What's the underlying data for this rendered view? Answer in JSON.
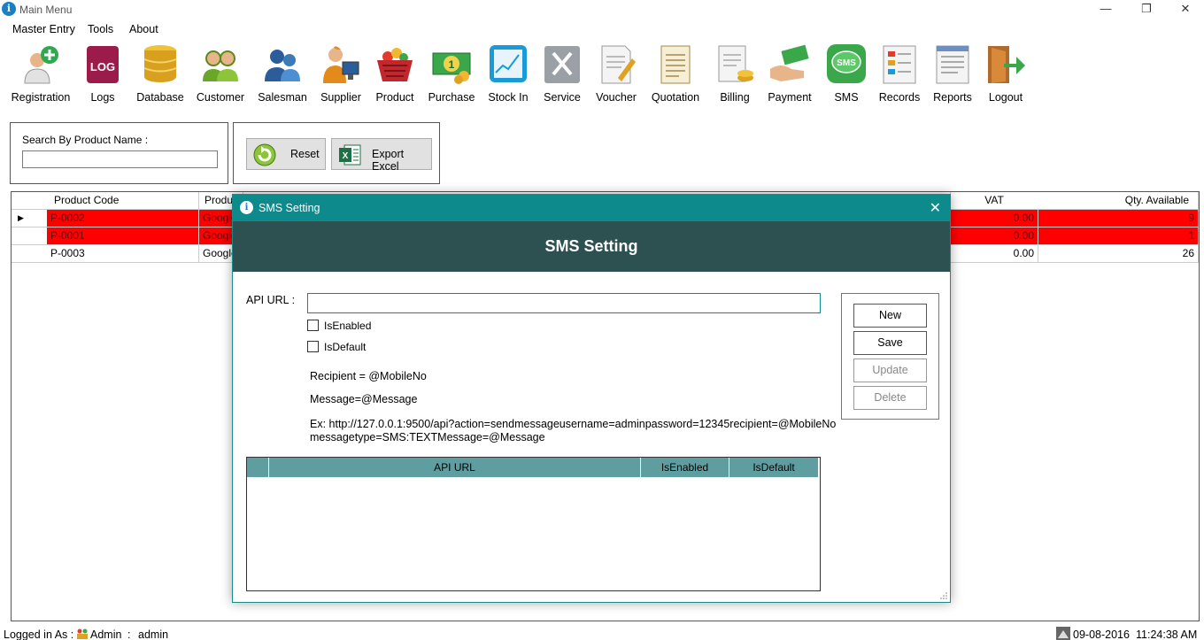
{
  "window": {
    "title": "Main Menu",
    "controls": [
      "—",
      "❐",
      "✕"
    ]
  },
  "menu": [
    "Master Entry",
    "Tools",
    "About"
  ],
  "toolbar": [
    {
      "label": "Registration",
      "icon": "registration-icon"
    },
    {
      "label": "Logs",
      "icon": "log-icon"
    },
    {
      "label": "Database",
      "icon": "database-icon"
    },
    {
      "label": "Customer",
      "icon": "customer-icon"
    },
    {
      "label": "Salesman",
      "icon": "salesman-icon"
    },
    {
      "label": "Supplier",
      "icon": "supplier-icon"
    },
    {
      "label": "Product",
      "icon": "product-basket-icon"
    },
    {
      "label": "Purchase",
      "icon": "money-icon"
    },
    {
      "label": "Stock In",
      "icon": "stock-chart-icon"
    },
    {
      "label": "Service",
      "icon": "tools-icon"
    },
    {
      "label": "Voucher",
      "icon": "voucher-icon"
    },
    {
      "label": "Quotation",
      "icon": "quotation-icon"
    },
    {
      "label": "Billing",
      "icon": "billing-icon"
    },
    {
      "label": "Payment",
      "icon": "payment-icon"
    },
    {
      "label": "SMS",
      "icon": "sms-icon"
    },
    {
      "label": "Records",
      "icon": "records-icon"
    },
    {
      "label": "Reports",
      "icon": "reports-icon"
    },
    {
      "label": "Logout",
      "icon": "logout-icon"
    }
  ],
  "search": {
    "label": "Search By Product Name :",
    "value": ""
  },
  "buttons": {
    "reset": "Reset",
    "export": "Export Excel"
  },
  "grid": {
    "headers": {
      "code": "Product Code",
      "name": "Produc",
      "vat": "VAT",
      "qty": "Qty. Available"
    },
    "rows": [
      {
        "code": "P-0002",
        "name": "Google",
        "vat": "0.00",
        "qty": "9",
        "highlight": true,
        "current": true
      },
      {
        "code": "P-0001",
        "name": "Google",
        "vat": "0.00",
        "qty": "1",
        "highlight": true,
        "current": false
      },
      {
        "code": "P-0003",
        "name": "Google",
        "vat": "0.00",
        "qty": "26",
        "highlight": false,
        "current": false
      }
    ]
  },
  "status": {
    "logged_in": "Logged in As :",
    "role": "Admin",
    "separator": ":",
    "user": "admin",
    "date": "09-08-2016",
    "time": "11:24:38 AM"
  },
  "modal": {
    "title": "SMS Setting",
    "header": "SMS Setting",
    "api_label": "API URL :",
    "api_value": "",
    "is_enabled": "IsEnabled",
    "is_default": "IsDefault",
    "recipient": "Recipient = @MobileNo",
    "message": "Message=@Message",
    "example_1": "Ex:  http://127.0.0.1:9500/api?action=sendmessageusername=adminpassword=12345recipient=@MobileNo",
    "example_2": "messagetype=SMS:TEXTMessage=@Message",
    "btn_new": "New",
    "btn_save": "Save",
    "btn_update": "Update",
    "btn_delete": "Delete",
    "grid_headers": [
      "API URL",
      "IsEnabled",
      "IsDefault"
    ]
  },
  "colors": {
    "accent": "#0c8a8c",
    "header_dark": "#2d5050",
    "row_highlight": "#ff0000",
    "grid_header": "#5f9ea0"
  }
}
